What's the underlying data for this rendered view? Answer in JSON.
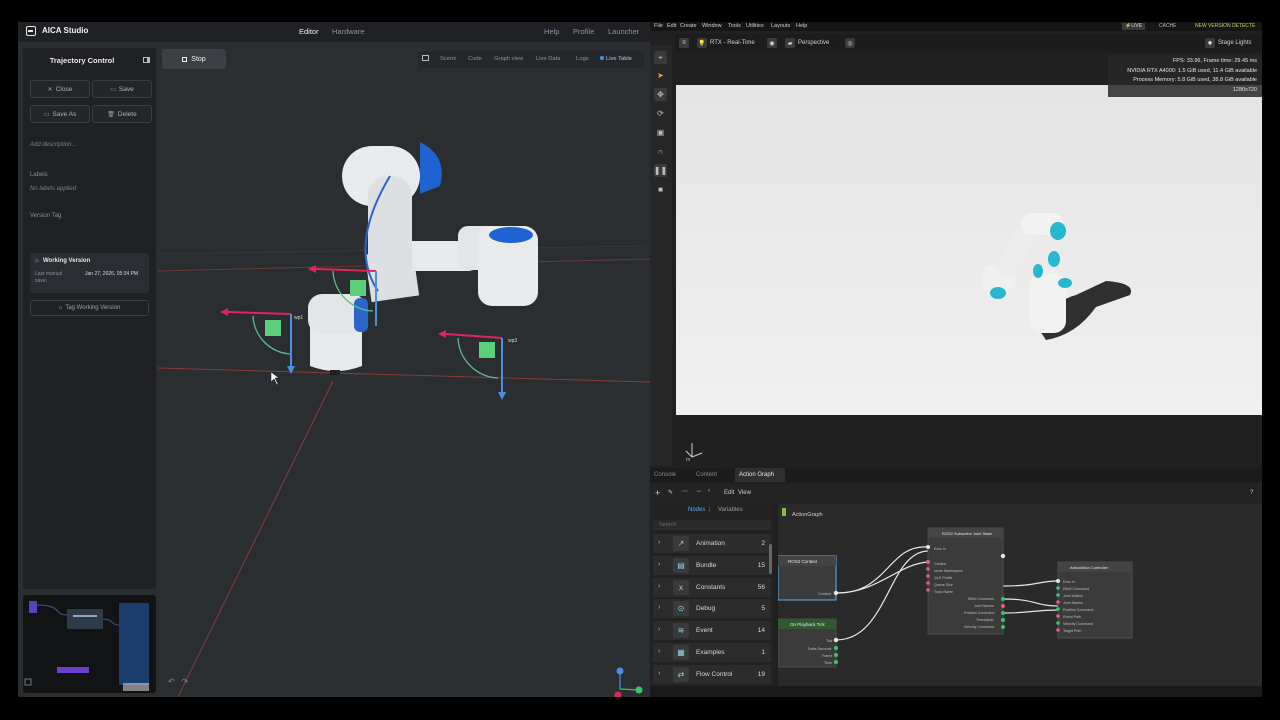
{
  "aica": {
    "app_title": "AICA Studio",
    "nav": {
      "editor": "Editor",
      "hardware": "Hardware",
      "help": "Help",
      "profile": "Profile",
      "launcher": "Launcher"
    },
    "sidebar": {
      "title": "Trajectory Control",
      "close_label": "Close",
      "save_label": "Save",
      "save_as_label": "Save As",
      "delete_label": "Delete",
      "description_placeholder": "Add description...",
      "labels_heading": "Labels",
      "no_labels": "No labels applied",
      "version_tag_heading": "Version Tag",
      "version_name": "Working Version",
      "last_save_label": "Last manual save:",
      "last_save_value": "Jan 27, 2026, 05:34 PM",
      "tag_button": "Tag Working Version"
    },
    "stop_label": "Stop",
    "view_tabs": [
      "Scene",
      "Code",
      "Graph view",
      "Live Data",
      "Logs",
      "Live Table"
    ],
    "waypoints": [
      "wp1",
      "wp2",
      "wp3"
    ]
  },
  "isaac": {
    "menu": [
      "File",
      "Edit",
      "Create",
      "Window",
      "Tools",
      "Utilities",
      "Layouts",
      "Help"
    ],
    "live_label": "LIVE",
    "cache_label": "CACHE",
    "new_version": "NEW VERSION DETECTE",
    "render_mode": "RTX - Real-Time",
    "camera": "Perspective",
    "stage_lights": "Stage Lights",
    "stats": {
      "fps": "FPS: 33.96, Frame time: 29.45 ms",
      "gpu": "NVIDIA RTX A4000: 1.5 GiB used, 11.4 GiB available",
      "process": "Process Memory: 5.8 GiB used, 38.8 GiB available",
      "resolution": "1280x720"
    },
    "axis_unit": "m",
    "bottom_tabs": [
      "Console",
      "Content",
      "Action Graph"
    ],
    "toolbar": {
      "edit": "Edit",
      "view": "View",
      "help": "?"
    },
    "nodes_tabs": {
      "nodes": "Nodes",
      "variables": "Variables"
    },
    "search_placeholder": "Search",
    "node_categories": [
      {
        "label": "Animation",
        "count": "2"
      },
      {
        "label": "Bundle",
        "count": "15"
      },
      {
        "label": "Constants",
        "count": "56"
      },
      {
        "label": "Debug",
        "count": "5"
      },
      {
        "label": "Event",
        "count": "14"
      },
      {
        "label": "Examples",
        "count": "1"
      },
      {
        "label": "Flow Control",
        "count": "19"
      }
    ],
    "graph": {
      "title": "ActionGraph",
      "node_ros2_context": "ROS2 Context",
      "node_ros2_context_port": "Context",
      "node_playback": "On Playback Tick",
      "node_playback_ports": [
        "Tick",
        "Delta Seconds",
        "Frame",
        "Time"
      ],
      "node_subscribe": "ROS2 Subscribe Joint State",
      "node_subscribe_inputs": [
        "Exec In",
        "Context",
        "Node Namespace",
        "QoS Profile",
        "Queue Size",
        "Topic Name"
      ],
      "node_subscribe_outputs": [
        "Effort Command",
        "Joint Names",
        "Position Command",
        "Timestamp",
        "Velocity Command"
      ],
      "node_articulation": "Articulation Controller",
      "node_articulation_ports": [
        "Exec In",
        "Effort Command",
        "Joint Indices",
        "Joint Names",
        "Position Command",
        "Robot Path",
        "Velocity Command",
        "Target Prim"
      ]
    }
  }
}
